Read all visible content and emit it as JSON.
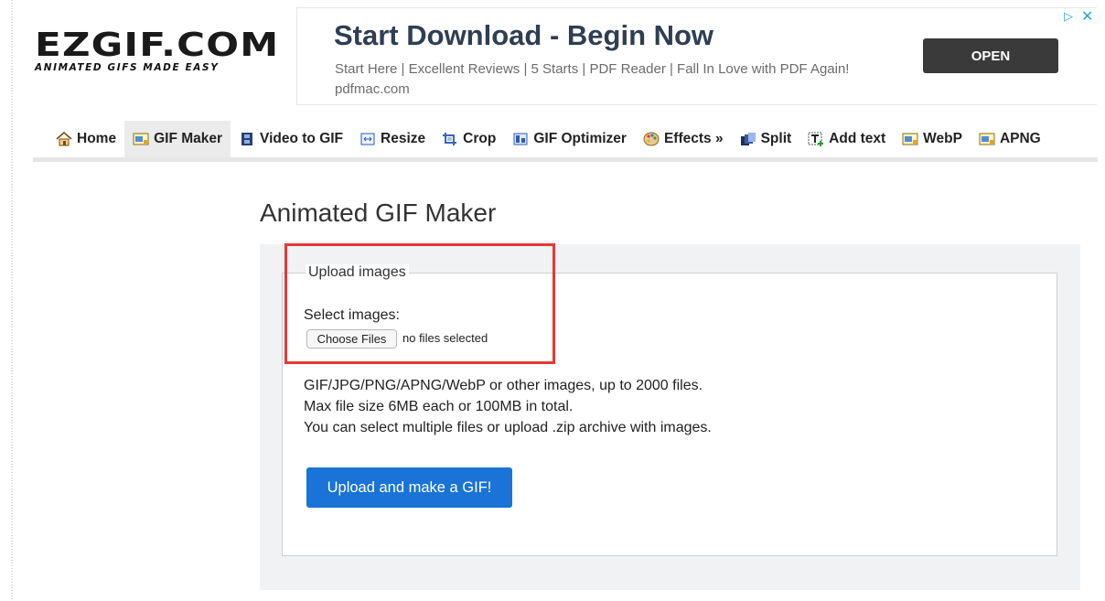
{
  "logo": {
    "text": "EZGIF.COM",
    "tagline": "ANIMATED GIFS MADE EASY"
  },
  "ad": {
    "title": "Start Download - Begin Now",
    "description": "Start Here | Excellent Reviews | 5 Starts | PDF Reader | Fall In Love with PDF Again! pdfmac.com",
    "button": "OPEN",
    "icons": [
      "ad-choices-icon",
      "close-icon"
    ]
  },
  "nav": {
    "items": [
      {
        "label": "Home",
        "icon": "house-icon"
      },
      {
        "label": "GIF Maker",
        "icon": "gif-image-icon",
        "active": true
      },
      {
        "label": "Video to GIF",
        "icon": "film-icon"
      },
      {
        "label": "Resize",
        "icon": "resize-icon"
      },
      {
        "label": "Crop",
        "icon": "crop-icon"
      },
      {
        "label": "GIF Optimizer",
        "icon": "optimizer-icon"
      },
      {
        "label": "Effects »",
        "icon": "palette-icon"
      },
      {
        "label": "Split",
        "icon": "split-icon"
      },
      {
        "label": "Add text",
        "icon": "text-icon"
      },
      {
        "label": "WebP",
        "icon": "webp-image-icon"
      },
      {
        "label": "APNG",
        "icon": "apng-image-icon"
      }
    ]
  },
  "page": {
    "title": "Animated GIF Maker"
  },
  "form": {
    "legend": "Upload images",
    "select_label": "Select images:",
    "choose_files": "Choose Files",
    "no_files": "no files selected",
    "info": [
      "GIF/JPG/PNG/APNG/WebP or other images, up to 2000 files.",
      "Max file size 6MB each or 100MB in total.",
      "You can select multiple files or upload .zip archive with images."
    ],
    "submit": "Upload and make a GIF!"
  },
  "colors": {
    "accent": "#1a73d6",
    "highlight": "#e53935",
    "ad_button": "#3a3a3a"
  }
}
